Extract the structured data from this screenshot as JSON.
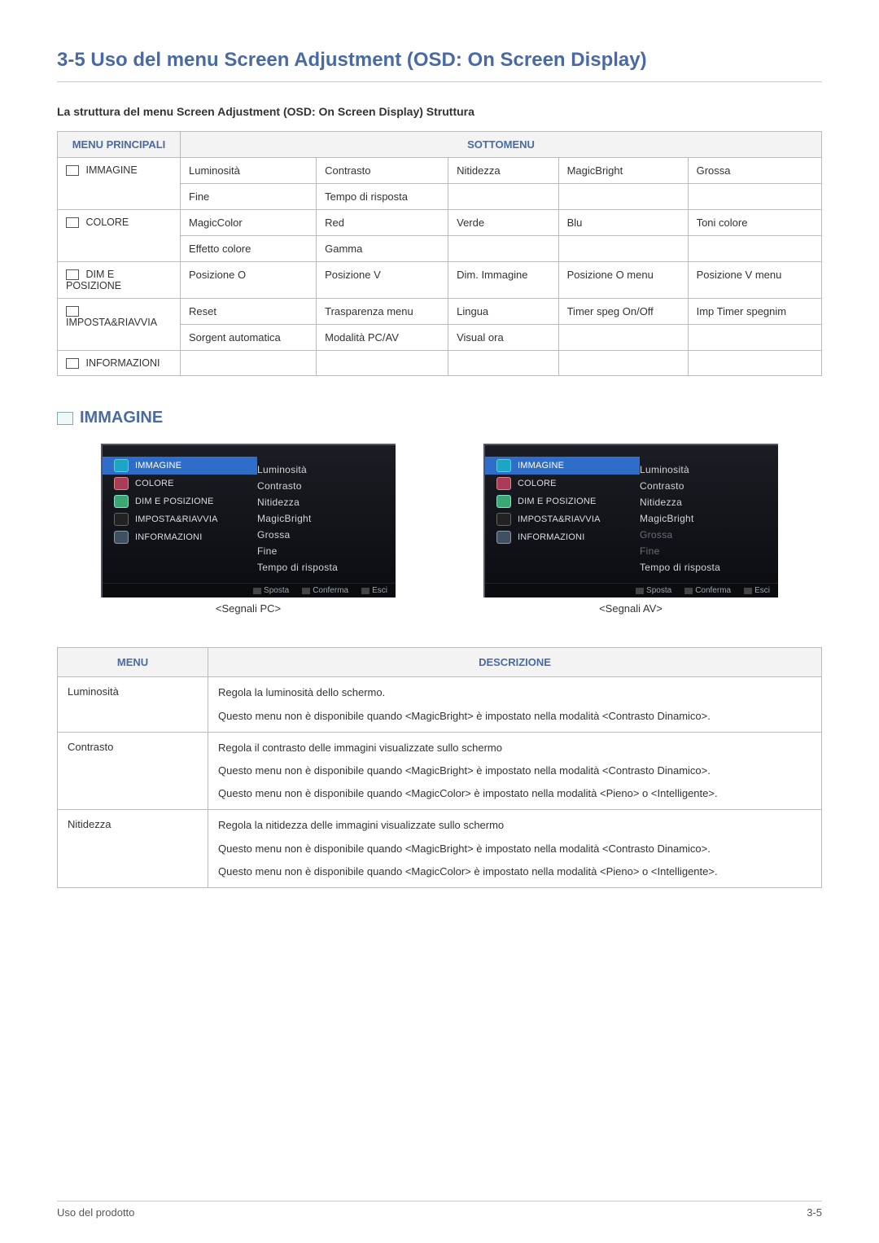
{
  "title": "3-5   Uso del menu Screen Adjustment (OSD: On Screen Display)",
  "subtitle": "La struttura del menu Screen Adjustment (OSD: On Screen Display) Struttura",
  "struct_table": {
    "header_menu": "MENU PRINCIPALI",
    "header_sub": "SOTTOMENU",
    "rows": [
      {
        "menu": "IMMAGINE",
        "icon": "immagine-icon",
        "cells": [
          [
            "Luminosità",
            "Contrasto",
            "Nitidezza",
            "MagicBright",
            "Grossa"
          ],
          [
            "Fine",
            "Tempo di risposta",
            "",
            "",
            ""
          ]
        ]
      },
      {
        "menu": "COLORE",
        "icon": "colore-icon",
        "cells": [
          [
            "MagicColor",
            "Red",
            "Verde",
            "Blu",
            "Toni colore"
          ],
          [
            "Effetto colore",
            "Gamma",
            "",
            "",
            ""
          ]
        ]
      },
      {
        "menu": "DIM E POSIZIONE",
        "icon": "dim-posizione-icon",
        "cells": [
          [
            "Posizione O",
            "Posizione V",
            "Dim. Immagine",
            "Posizione O menu",
            "Posizione V menu"
          ]
        ]
      },
      {
        "menu": "IMPOSTA&RIAVVIA",
        "icon": "imposta-icon",
        "cells": [
          [
            "Reset",
            "Trasparenza menu",
            "Lingua",
            "Timer speg On/Off",
            "Imp Timer spegnim"
          ],
          [
            "Sorgent automatica",
            "Modalità PC/AV",
            "Visual ora",
            "",
            ""
          ]
        ]
      },
      {
        "menu": "INFORMAZIONI",
        "icon": "informazioni-icon",
        "cells": [
          [
            "",
            "",
            "",
            "",
            ""
          ]
        ]
      }
    ]
  },
  "section_heading": "IMMAGINE",
  "osd": {
    "left_items": [
      {
        "label": "IMMAGINE",
        "icon": "oi-img",
        "selected": true
      },
      {
        "label": "COLORE",
        "icon": "oi-col"
      },
      {
        "label": "DIM E POSIZIONE",
        "icon": "oi-dim"
      },
      {
        "label": "IMPOSTA&RIAVVIA",
        "icon": "oi-set"
      },
      {
        "label": "INFORMAZIONI",
        "icon": "oi-inf"
      }
    ],
    "pc_right": [
      "Luminosità",
      "Contrasto",
      "Nitidezza",
      "MagicBright",
      "Grossa",
      "Fine",
      "Tempo di risposta"
    ],
    "av_right": [
      {
        "t": "Luminosità"
      },
      {
        "t": "Contrasto"
      },
      {
        "t": "Nitidezza"
      },
      {
        "t": "MagicBright"
      },
      {
        "t": "Grossa",
        "dim": true
      },
      {
        "t": "Fine",
        "dim": true
      },
      {
        "t": "Tempo di risposta"
      }
    ],
    "footer": [
      "Sposta",
      "Conferma",
      "Esci"
    ],
    "caption_pc": "<Segnali PC>",
    "caption_av": "<Segnali AV>"
  },
  "desc_table": {
    "header_menu": "MENU",
    "header_desc": "DESCRIZIONE",
    "rows": [
      {
        "menu": "Luminosità",
        "desc": [
          "Regola la luminosità dello schermo.",
          "Questo menu non è disponibile quando <MagicBright> è impostato nella modalità <Contrasto Dinamico>."
        ]
      },
      {
        "menu": "Contrasto",
        "desc": [
          "Regola il contrasto delle immagini visualizzate sullo schermo",
          "Questo menu non è disponibile quando <MagicBright> è impostato nella modalità <Contrasto Dinamico>.",
          "Questo menu non è disponibile quando <MagicColor> è impostato nella modalità <Pieno> o <Intelligente>."
        ]
      },
      {
        "menu": "Nitidezza",
        "desc": [
          "Regola la nitidezza delle immagini visualizzate sullo schermo",
          "Questo menu non è disponibile quando <MagicBright> è impostato nella modalità <Contrasto Dinamico>.",
          "Questo menu non è disponibile quando <MagicColor> è impostato nella modalità <Pieno> o <Intelligente>."
        ]
      }
    ]
  },
  "footer_left": "Uso del prodotto",
  "footer_right": "3-5"
}
